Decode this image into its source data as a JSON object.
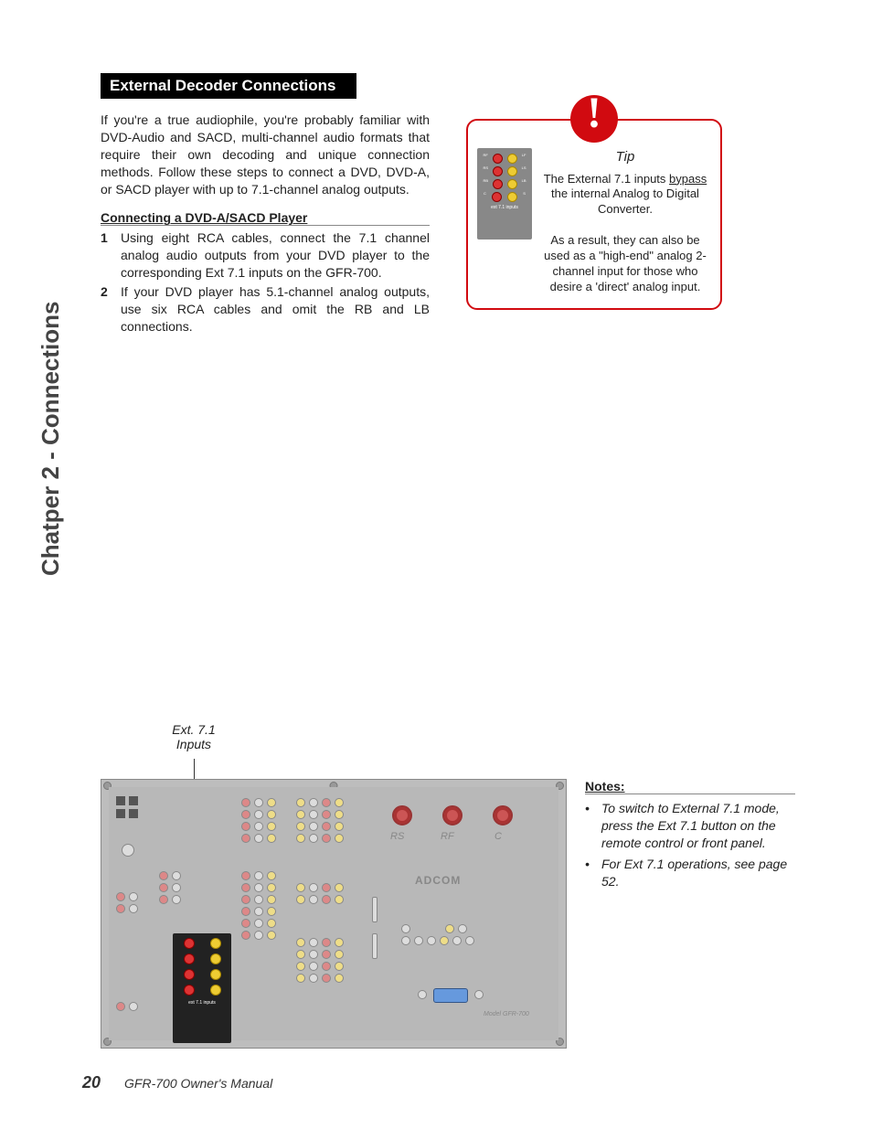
{
  "section_title": "External Decoder Connections",
  "intro": "If you're a true audiophile, you're probably familiar with DVD-Audio and SACD, multi-channel audio formats that require their own decoding and unique connection methods. Follow these steps to connect a DVD, DVD-A, or SACD player with up to 7.1-channel analog outputs.",
  "subhead": "Connecting a DVD-A/SACD Player",
  "steps": [
    {
      "n": "1",
      "text": "Using eight RCA cables, connect the 7.1 channel analog audio outputs from your DVD player to the corresponding Ext 7.1 inputs on the GFR-700."
    },
    {
      "n": "2",
      "text": "If your DVD player has 5.1-channel analog outputs, use six RCA cables and omit the RB and LB connections."
    }
  ],
  "tip": {
    "badge": "!",
    "title": "Tip",
    "line1_a": "The External 7.1 inputs ",
    "line1_u": "bypass",
    "line1_b": " the internal Analog to Digital Converter.",
    "line2": "As a result, they can also be used as a \"high-end\" analog 2-channel input for those who desire a 'direct' analog input.",
    "connector_label": "ext 7.1 inputs",
    "jack_labels": {
      "rf": "RF",
      "lf": "LF",
      "rs": "RS",
      "ls": "LS",
      "rb": "RB",
      "lb": "LB",
      "c": "C",
      "s": "S"
    }
  },
  "chapter_label": "Chatper 2 - Connections",
  "diagram": {
    "callout": "Ext. 7.1 Inputs",
    "panel_labels": {
      "rs": "RS",
      "rf": "RF",
      "c": "C"
    },
    "logo": "ADCOM",
    "model": "Model GFR-700"
  },
  "notes": {
    "heading": "Notes:",
    "items": [
      "To switch to External 7.1 mode, press the Ext 7.1 button on the remote control or front panel.",
      "For Ext 7.1 operations, see page 52."
    ]
  },
  "footer": {
    "page": "20",
    "manual": "GFR-700 Owner's Manual"
  }
}
